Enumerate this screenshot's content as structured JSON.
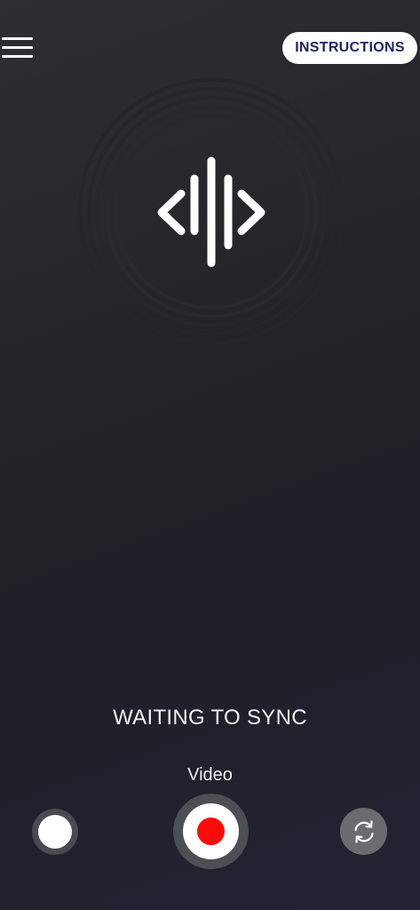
{
  "header": {
    "menu_icon": "hamburger-menu-icon",
    "instructions_label": "INSTRUCTIONS"
  },
  "sync_visual": {
    "icon": "sync-waveform-icon"
  },
  "status": {
    "text": "WAITING TO SYNC"
  },
  "controls": {
    "mode_label": "Video",
    "left_button_icon": "white-circle-icon",
    "record_button_icon": "record-dot-icon",
    "switch_camera_icon": "switch-camera-icon"
  },
  "colors": {
    "accent_record": "#ff0a0a",
    "instructions_text": "#1d2560",
    "background_top": "#2f2f33",
    "background_bottom": "#232433"
  }
}
